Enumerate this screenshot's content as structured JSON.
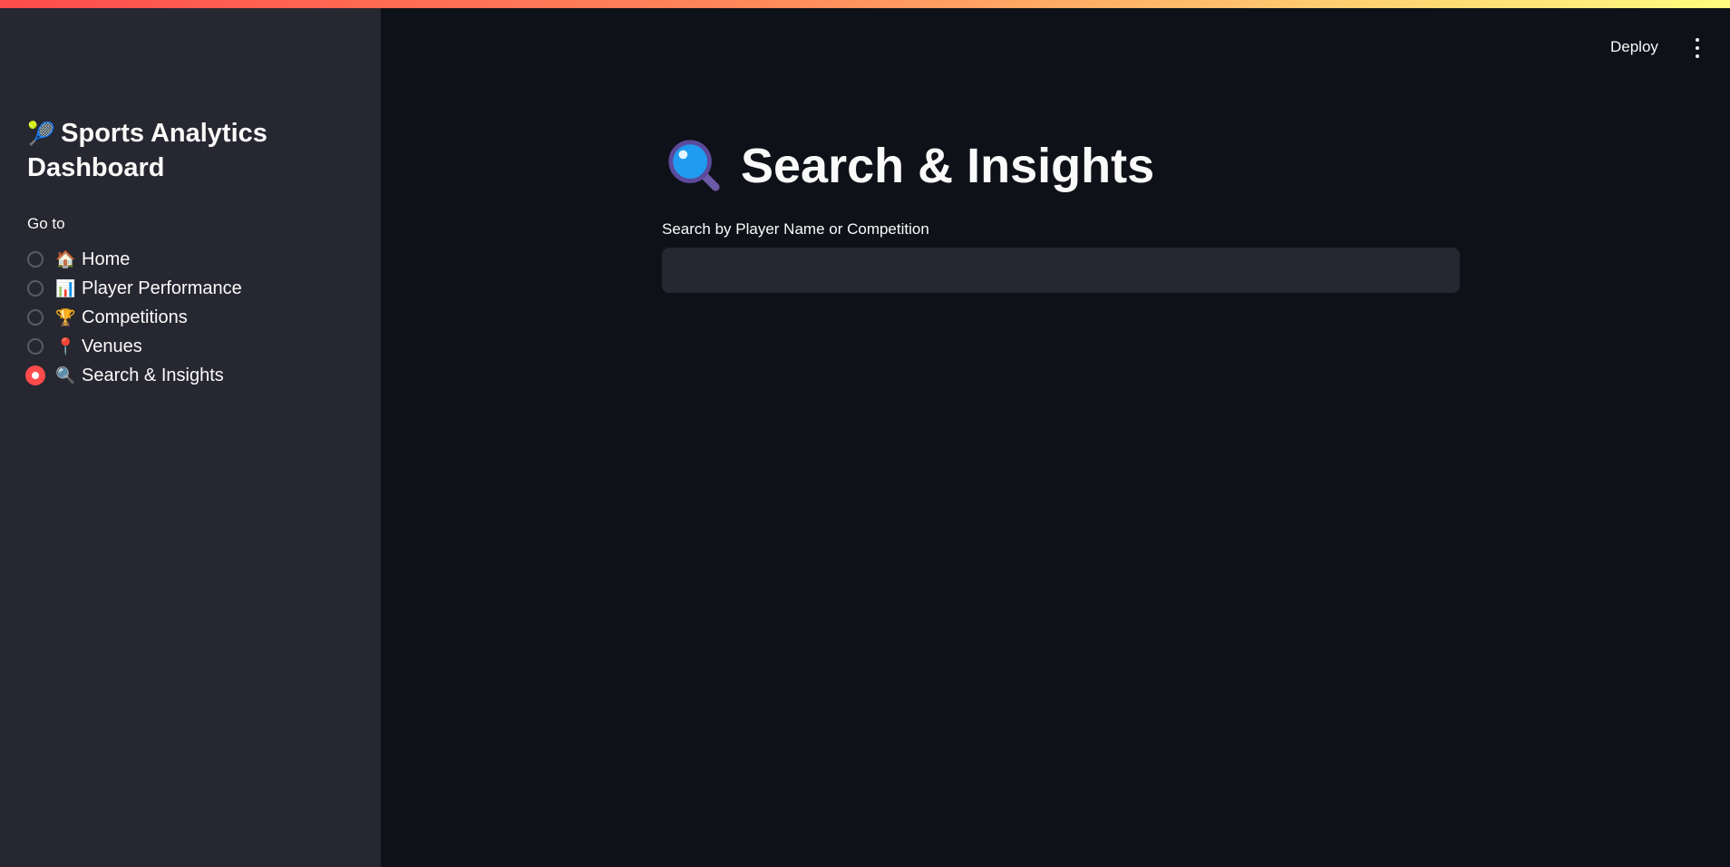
{
  "colors": {
    "accent": "#ff4b4b",
    "background": "#0e1117",
    "sidebar_bg": "#262730",
    "text": "#fafafa"
  },
  "header": {
    "deploy_label": "Deploy",
    "menu_icon": "vertical-ellipsis-icon"
  },
  "sidebar": {
    "title_emoji": "🎾",
    "title": "Sports Analytics Dashboard",
    "nav_label": "Go to",
    "items": [
      {
        "emoji": "🏠",
        "label": "Home",
        "selected": false
      },
      {
        "emoji": "📊",
        "label": "Player Performance",
        "selected": false
      },
      {
        "emoji": "🏆",
        "label": "Competitions",
        "selected": false
      },
      {
        "emoji": "📍",
        "label": "Venues",
        "selected": false
      },
      {
        "emoji": "🔍",
        "label": "Search & Insights",
        "selected": true
      }
    ]
  },
  "main": {
    "title_icon": "magnifying-glass-icon",
    "title": "Search & Insights",
    "search": {
      "label": "Search by Player Name or Competition",
      "value": "",
      "placeholder": ""
    }
  }
}
